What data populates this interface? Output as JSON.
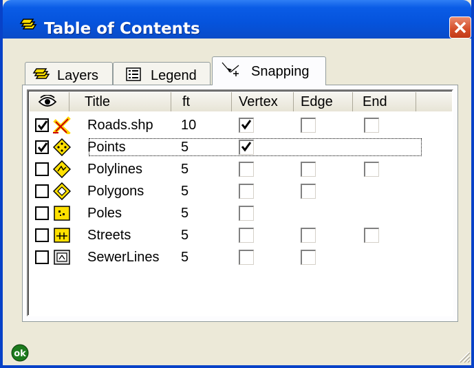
{
  "window": {
    "title": "Table of Contents",
    "close_icon": "close-icon",
    "title_icon": "layers-icon",
    "titlebar_color": "#0553dc",
    "close_color": "#d44d28"
  },
  "tabs": [
    {
      "label": "Layers",
      "icon": "layers-icon",
      "active": false
    },
    {
      "label": "Legend",
      "icon": "legend-icon",
      "active": false
    },
    {
      "label": "Snapping",
      "icon": "snapping-icon",
      "active": true
    }
  ],
  "columns": {
    "eye_icon": "eye-icon",
    "title": "Title",
    "ft": "ft",
    "vertex": "Vertex",
    "edge": "Edge",
    "end": "End"
  },
  "rows": [
    {
      "title": "Roads.shp",
      "ft": "10",
      "checked": true,
      "icon": "roads-layer-icon",
      "vertex": true,
      "edge": false,
      "end": false,
      "has_edge": true,
      "has_end": true
    },
    {
      "title": "Points",
      "ft": "5",
      "checked": true,
      "icon": "points-layer-icon",
      "vertex": true,
      "edge": null,
      "end": null,
      "has_edge": false,
      "has_end": false,
      "focused": true
    },
    {
      "title": "Polylines",
      "ft": "5",
      "checked": false,
      "icon": "polylines-layer-icon",
      "vertex": false,
      "edge": false,
      "end": false,
      "has_edge": true,
      "has_end": true
    },
    {
      "title": "Polygons",
      "ft": "5",
      "checked": false,
      "icon": "polygons-layer-icon",
      "vertex": false,
      "edge": false,
      "end": null,
      "has_edge": true,
      "has_end": false
    },
    {
      "title": "Poles",
      "ft": "5",
      "checked": false,
      "icon": "poles-layer-icon",
      "vertex": false,
      "edge": null,
      "end": null,
      "has_edge": false,
      "has_end": false
    },
    {
      "title": "Streets",
      "ft": "5",
      "checked": false,
      "icon": "streets-layer-icon",
      "vertex": false,
      "edge": false,
      "end": false,
      "has_edge": true,
      "has_end": true
    },
    {
      "title": "SewerLines",
      "ft": "5",
      "checked": false,
      "icon": "sewerlines-layer-icon",
      "vertex": false,
      "edge": false,
      "end": null,
      "has_edge": true,
      "has_end": false
    }
  ],
  "status": {
    "ok_icon": "ok-icon",
    "ok_label": "ok"
  }
}
